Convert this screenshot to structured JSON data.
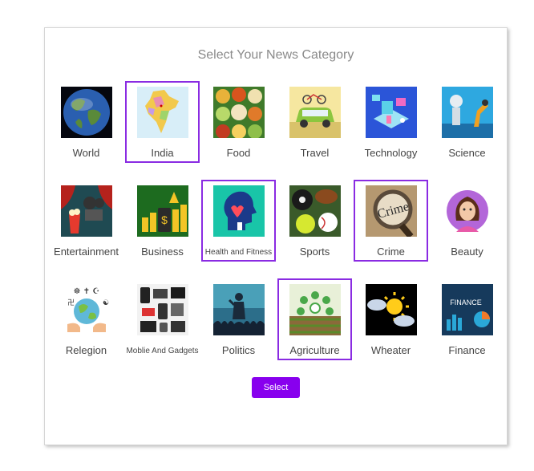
{
  "page": {
    "title": "Select Your News Category",
    "select_label": "Select",
    "accent_color": "#8800ee",
    "selected_border_color": "#8a2be2"
  },
  "categories": [
    {
      "label": "World",
      "icon": "globe-icon",
      "selected": false
    },
    {
      "label": "India",
      "icon": "india-map-icon",
      "selected": true
    },
    {
      "label": "Food",
      "icon": "food-icon",
      "selected": false
    },
    {
      "label": "Travel",
      "icon": "travel-car-icon",
      "selected": false
    },
    {
      "label": "Technology",
      "icon": "technology-icon",
      "selected": false
    },
    {
      "label": "Science",
      "icon": "robot-arm-icon",
      "selected": false
    },
    {
      "label": "Entertainment",
      "icon": "popcorn-film-icon",
      "selected": false
    },
    {
      "label": "Business",
      "icon": "business-growth-icon",
      "selected": false
    },
    {
      "label": "Health and Fitness",
      "icon": "health-head-icon",
      "selected": true
    },
    {
      "label": "Sports",
      "icon": "sports-balls-icon",
      "selected": false
    },
    {
      "label": "Crime",
      "icon": "crime-magnifier-icon",
      "selected": true
    },
    {
      "label": "Beauty",
      "icon": "beauty-woman-icon",
      "selected": false
    },
    {
      "label": "Relegion",
      "icon": "religion-globe-icon",
      "selected": false
    },
    {
      "label": "Moblie And Gadgets",
      "icon": "gadgets-icon",
      "selected": false
    },
    {
      "label": "Politics",
      "icon": "politics-speaker-icon",
      "selected": false
    },
    {
      "label": "Agriculture",
      "icon": "agriculture-icon",
      "selected": true
    },
    {
      "label": "Wheater",
      "icon": "weather-sun-cloud-icon",
      "selected": false
    },
    {
      "label": "Finance",
      "icon": "finance-chart-icon",
      "selected": false
    }
  ]
}
